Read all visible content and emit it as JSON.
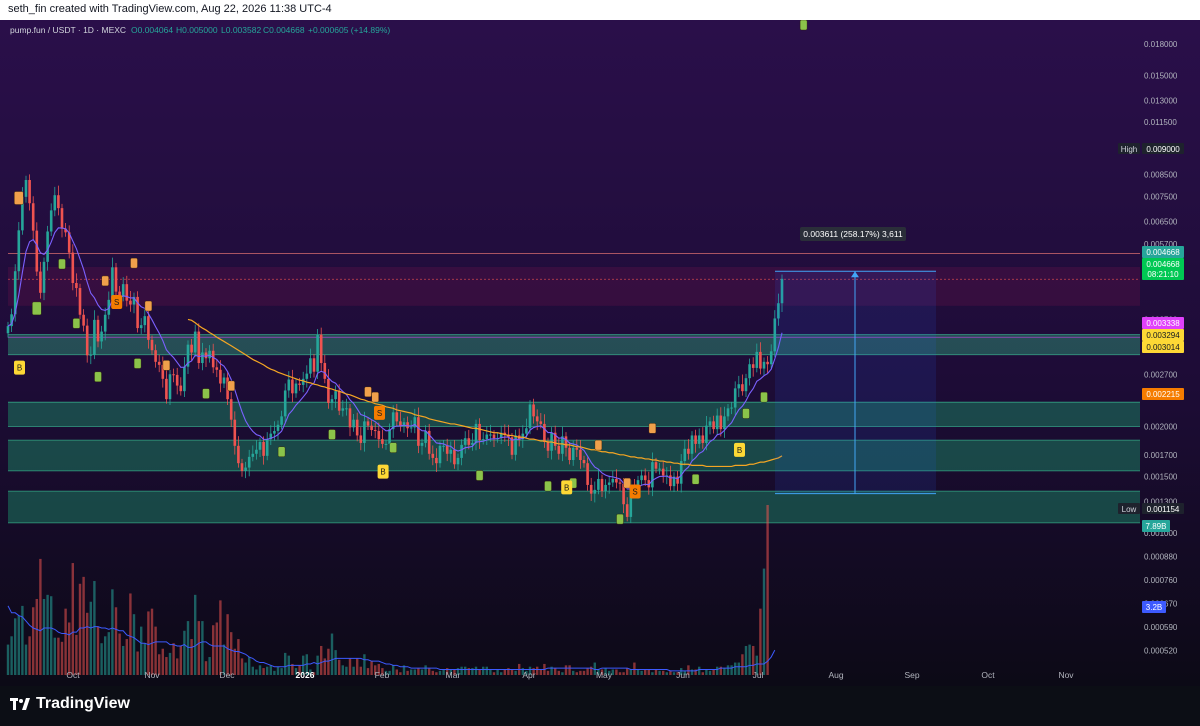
{
  "header": {
    "credit": "seth_fin created with TradingView.com, Aug 22, 2026 11:38 UTC-4"
  },
  "legend": {
    "symbol": "pump.fun / USDT · 1D · MEXC",
    "open": "O0.004064",
    "high": "H0.005000",
    "low": "L0.003582",
    "close": "C0.004668",
    "change": "+0.000605 (+14.89%)"
  },
  "price_scale": {
    "ticks": [
      "0.018000",
      "0.015000",
      "0.013000",
      "0.011500",
      "0.010000",
      "0.008500",
      "0.007500",
      "0.006500",
      "0.005700",
      "0.003700",
      "0.002700",
      "0.002000",
      "0.001700",
      "0.001500",
      "0.001300",
      "0.001000",
      "0.000880",
      "0.000760",
      "0.000670",
      "0.000590",
      "0.000520"
    ],
    "high_tag": "High",
    "high_value": "0.009000",
    "low_tag": "Low",
    "low_value": "0.001154",
    "last_price": "0.004668",
    "close_price": "0.004668",
    "countdown": "08:21:10",
    "level_a": "0.003338",
    "level_b": "0.003294",
    "level_c": "0.003014",
    "ma_value": "0.002215",
    "vol_high": "7.89B",
    "vol_ma": "3.2B"
  },
  "time_axis": [
    "Oct",
    "Nov",
    "Dec",
    "2026",
    "Feb",
    "Mar",
    "Apr",
    "May",
    "Jun",
    "Jul",
    "Aug",
    "Sep",
    "Oct",
    "Nov"
  ],
  "measure": {
    "label": "0.003611 (258.17%) 3,611"
  },
  "signal_letters": {
    "buy": "B",
    "sell": "S"
  },
  "footer": {
    "brand": "TradingView"
  },
  "colors": {
    "bg_top": "#2a0f4a",
    "bg_bottom": "#0f0a1c",
    "up": "#26a69a",
    "down": "#ef5350",
    "zone": "#1b7a5f",
    "ma_long": "#f5a623",
    "ma_short": "#7b61ff",
    "accent": "#5c6bc0"
  },
  "chart_data": {
    "type": "candlestick",
    "scale": "log",
    "ylim": [
      0.00048,
      0.0195
    ],
    "x_start": "2025-09-08",
    "x_end": "2026-11-30",
    "close": [
      0.00356,
      0.00381,
      0.00488,
      0.00617,
      0.00748,
      0.00824,
      0.00721,
      0.00616,
      0.00487,
      0.00431,
      0.00515,
      0.00613,
      0.00692,
      0.00755,
      0.00701,
      0.00623,
      0.0061,
      0.00543,
      0.00456,
      0.00443,
      0.0038,
      0.00357,
      0.00301,
      0.00302,
      0.00369,
      0.00326,
      0.00345,
      0.0038,
      0.00414,
      0.00499,
      0.00434,
      0.00421,
      0.00453,
      0.00412,
      0.00403,
      0.00421,
      0.00352,
      0.00358,
      0.00377,
      0.00329,
      0.0031,
      0.0029,
      0.00285,
      0.00263,
      0.00234,
      0.0027,
      0.00269,
      0.00253,
      0.00245,
      0.00282,
      0.0032,
      0.00306,
      0.00345,
      0.00288,
      0.00306,
      0.00296,
      0.00309,
      0.00281,
      0.00277,
      0.00256,
      0.00265,
      0.00234,
      0.00208,
      0.00179,
      0.00162,
      0.00155,
      0.00158,
      0.00168,
      0.00171,
      0.00175,
      0.00183,
      0.00169,
      0.00186,
      0.00192,
      0.00195,
      0.00202,
      0.00212,
      0.00246,
      0.00262,
      0.00242,
      0.00256,
      0.00254,
      0.00263,
      0.00271,
      0.00296,
      0.00274,
      0.00339,
      0.00288,
      0.00263,
      0.00229,
      0.00234,
      0.00245,
      0.00219,
      0.00222,
      0.00222,
      0.00199,
      0.00208,
      0.0019,
      0.00182,
      0.00206,
      0.00201,
      0.00196,
      0.00195,
      0.00186,
      0.00181,
      0.00181,
      0.00197,
      0.00217,
      0.00206,
      0.00201,
      0.00205,
      0.00198,
      0.00199,
      0.00211,
      0.00179,
      0.00182,
      0.00195,
      0.00171,
      0.00167,
      0.00162,
      0.00179,
      0.00179,
      0.00171,
      0.00175,
      0.00161,
      0.00167,
      0.0018,
      0.00187,
      0.0018,
      0.00182,
      0.00203,
      0.00185,
      0.00186,
      0.00191,
      0.00191,
      0.00187,
      0.00187,
      0.00193,
      0.00191,
      0.00188,
      0.0017,
      0.0019,
      0.00186,
      0.00192,
      0.00198,
      0.00227,
      0.00212,
      0.00206,
      0.00203,
      0.00183,
      0.00174,
      0.00193,
      0.00179,
      0.00171,
      0.00189,
      0.00177,
      0.00165,
      0.00177,
      0.00175,
      0.00165,
      0.00162,
      0.00143,
      0.00136,
      0.00139,
      0.00148,
      0.00138,
      0.00143,
      0.00145,
      0.00148,
      0.00145,
      0.00144,
      0.00128,
      0.00119,
      0.0014,
      0.00139,
      0.00147,
      0.00151,
      0.00147,
      0.00141,
      0.00163,
      0.00157,
      0.00157,
      0.00151,
      0.00151,
      0.00142,
      0.0015,
      0.00144,
      0.00164,
      0.00176,
      0.00171,
      0.0019,
      0.00181,
      0.0019,
      0.00182,
      0.00201,
      0.00206,
      0.00197,
      0.00213,
      0.00197,
      0.00212,
      0.00222,
      0.00223,
      0.00249,
      0.00255,
      0.00245,
      0.00264,
      0.00286,
      0.0028,
      0.00307,
      0.00279,
      0.0029,
      0.00286,
      0.00308,
      0.00372,
      0.00406,
      0.00467
    ],
    "ma_long": [
      null,
      null,
      null,
      null,
      null,
      null,
      null,
      null,
      null,
      null,
      null,
      null,
      null,
      null,
      null,
      null,
      null,
      null,
      null,
      null,
      null,
      null,
      null,
      null,
      null,
      null,
      null,
      null,
      null,
      null,
      null,
      null,
      null,
      null,
      null,
      null,
      null,
      null,
      null,
      null,
      null,
      null,
      null,
      null,
      null,
      null,
      null,
      null,
      null,
      null,
      0.0037,
      0.00368,
      0.00363,
      0.00357,
      0.00352,
      0.00348,
      0.00343,
      0.00339,
      0.00334,
      0.0033,
      0.00326,
      0.00322,
      0.00318,
      0.00314,
      0.0031,
      0.00306,
      0.00302,
      0.00298,
      0.00294,
      0.00291,
      0.00288,
      0.00285,
      0.00281,
      0.00278,
      0.00276,
      0.00273,
      0.00271,
      0.00269,
      0.00267,
      0.00265,
      0.00263,
      0.00261,
      0.0026,
      0.00258,
      0.00257,
      0.00255,
      0.00254,
      0.00252,
      0.00251,
      0.00249,
      0.00248,
      0.00246,
      0.00245,
      0.00243,
      0.00241,
      0.0024,
      0.00238,
      0.00236,
      0.00234,
      0.00233,
      0.00231,
      0.0023,
      0.00228,
      0.00227,
      0.00226,
      0.00224,
      0.00223,
      0.00222,
      0.0022,
      0.00219,
      0.00218,
      0.00217,
      0.00216,
      0.00214,
      0.00213,
      0.00212,
      0.00211,
      0.00209,
      0.00208,
      0.00207,
      0.00206,
      0.00205,
      0.00204,
      0.00203,
      0.00203,
      0.00202,
      0.00201,
      0.002,
      0.00199,
      0.00198,
      0.00198,
      0.00197,
      0.00196,
      0.00195,
      0.00194,
      0.00193,
      0.00193,
      0.00192,
      0.00191,
      0.0019,
      0.0019,
      0.00189,
      0.00188,
      0.00188,
      0.00187,
      0.00186,
      0.00186,
      0.00185,
      0.00184,
      0.00184,
      0.00183,
      0.00183,
      0.00182,
      0.00181,
      0.00181,
      0.0018,
      0.0018,
      0.00179,
      0.00178,
      0.00178,
      0.00177,
      0.00176,
      0.00175,
      0.00175,
      0.00174,
      0.00173,
      0.00173,
      0.00172,
      0.00172,
      0.00171,
      0.0017,
      0.0017,
      0.00169,
      0.00168,
      0.00168,
      0.00167,
      0.00167,
      0.00166,
      0.00166,
      0.00165,
      0.00165,
      0.00164,
      0.00164,
      0.00163,
      0.00163,
      0.00162,
      0.00162,
      0.00161,
      0.00161,
      0.00161,
      0.0016,
      0.0016,
      0.0016,
      0.0016,
      0.00159,
      0.00159,
      0.00159,
      0.00159,
      0.00159,
      0.00159,
      0.00159,
      0.00159,
      0.0016,
      0.0016,
      0.0016,
      0.0016,
      0.00161,
      0.00161,
      0.00162,
      0.00163,
      0.00163,
      0.00164,
      0.00165,
      0.00166,
      0.00167,
      0.00169
    ],
    "volume": [
      0.22,
      0.28,
      0.41,
      0.43,
      0.5,
      0.22,
      0.28,
      0.49,
      0.55,
      0.84,
      0.55,
      0.58,
      0.57,
      0.27,
      0.27,
      0.24,
      0.48,
      0.38,
      0.81,
      0.29,
      0.66,
      0.71,
      0.45,
      0.53,
      0.68,
      0.35,
      0.23,
      0.28,
      0.31,
      0.62,
      0.49,
      0.3,
      0.21,
      0.26,
      0.59,
      0.44,
      0.17,
      0.35,
      0.23,
      0.46,
      0.48,
      0.35,
      0.15,
      0.19,
      0.13,
      0.16,
      0.23,
      0.12,
      0.21,
      0.32,
      0.39,
      0.26,
      0.58,
      0.39,
      0.39,
      0.1,
      0.13,
      0.36,
      0.38,
      0.54,
      0.22,
      0.44,
      0.31,
      0.19,
      0.26,
      0.12,
      0.09,
      0.13,
      0.06,
      0.04,
      0.07,
      0.05,
      0.06,
      0.07,
      0.03,
      0.06,
      0.05,
      0.16,
      0.14,
      0.08,
      0.05,
      0.07,
      0.14,
      0.15,
      0.04,
      0.02,
      0.14,
      0.21,
      0.12,
      0.19,
      0.3,
      0.18,
      0.11,
      0.07,
      0.06,
      0.12,
      0.06,
      0.12,
      0.06,
      0.15,
      0.05,
      0.1,
      0.07,
      0.08,
      0.05,
      0.03,
      0.03,
      0.07,
      0.04,
      0.02,
      0.07,
      0.03,
      0.04,
      0.04,
      0.05,
      0.04,
      0.07,
      0.05,
      0.03,
      0.02,
      0.03,
      0.04,
      0.05,
      0.04,
      0.04,
      0.05,
      0.06,
      0.06,
      0.05,
      0.05,
      0.06,
      0.04,
      0.06,
      0.06,
      0.04,
      0.02,
      0.04,
      0.02,
      0.04,
      0.05,
      0.04,
      0.03,
      0.08,
      0.05,
      0.03,
      0.06,
      0.05,
      0.06,
      0.04,
      0.08,
      0.03,
      0.06,
      0.05,
      0.03,
      0.02,
      0.07,
      0.07,
      0.03,
      0.02,
      0.03,
      0.03,
      0.05,
      0.06,
      0.09,
      0.04,
      0.04,
      0.05,
      0.03,
      0.04,
      0.04,
      0.02,
      0.02,
      0.05,
      0.04,
      0.09,
      0.04,
      0.03,
      0.04,
      0.04,
      0.02,
      0.04,
      0.03,
      0.03,
      0.02,
      0.03,
      0.02,
      0.02,
      0.05,
      0.03,
      0.07,
      0.04,
      0.04,
      0.06,
      0.02,
      0.04,
      0.03,
      0.04,
      0.06,
      0.06,
      0.05,
      0.07,
      0.07,
      0.09,
      0.09,
      0.15,
      0.21,
      0.22,
      0.21,
      0.14,
      0.48,
      0.77,
      1.23
    ],
    "vol_ma": [
      0.5,
      0.45,
      0.45,
      0.43,
      0.42,
      0.39,
      0.36,
      0.34,
      0.33,
      0.32,
      0.34,
      0.34,
      0.34,
      0.33,
      0.31,
      0.3,
      0.3,
      0.29,
      0.31,
      0.31,
      0.34,
      0.34,
      0.35,
      0.34,
      0.35,
      0.35,
      0.34,
      0.34,
      0.33,
      0.34,
      0.33,
      0.32,
      0.32,
      0.29,
      0.28,
      0.27,
      0.25,
      0.23,
      0.23,
      0.22,
      0.23,
      0.24,
      0.24,
      0.24,
      0.24,
      0.22,
      0.22,
      0.21,
      0.21,
      0.22,
      0.2,
      0.2,
      0.21,
      0.23,
      0.24,
      0.24,
      0.22,
      0.21,
      0.21,
      0.21,
      0.21,
      0.19,
      0.18,
      0.17,
      0.17,
      0.16,
      0.15,
      0.13,
      0.12,
      0.1,
      0.09,
      0.09,
      0.08,
      0.07,
      0.06,
      0.06,
      0.06,
      0.06,
      0.07,
      0.07,
      0.07,
      0.07,
      0.07,
      0.08,
      0.08,
      0.09,
      0.08,
      0.09,
      0.1,
      0.1,
      0.11,
      0.12,
      0.12,
      0.12,
      0.12,
      0.12,
      0.12,
      0.12,
      0.12,
      0.11,
      0.11,
      0.1,
      0.1,
      0.1,
      0.09,
      0.08,
      0.08,
      0.07,
      0.07,
      0.06,
      0.06,
      0.06,
      0.05,
      0.05,
      0.05,
      0.05,
      0.05,
      0.05,
      0.05,
      0.05,
      0.04,
      0.04,
      0.04,
      0.04,
      0.04,
      0.04,
      0.04,
      0.04,
      0.04,
      0.04,
      0.04,
      0.04,
      0.04,
      0.04,
      0.04,
      0.04,
      0.04,
      0.04,
      0.04,
      0.04,
      0.04,
      0.04,
      0.04,
      0.04,
      0.04,
      0.04,
      0.04,
      0.04,
      0.04,
      0.04,
      0.05,
      0.05,
      0.05,
      0.05,
      0.05,
      0.05,
      0.05,
      0.05,
      0.05,
      0.05,
      0.05,
      0.05,
      0.05,
      0.04,
      0.04,
      0.05,
      0.05,
      0.05,
      0.05,
      0.05,
      0.05,
      0.05,
      0.05,
      0.04,
      0.04,
      0.04,
      0.04,
      0.04,
      0.04,
      0.04,
      0.04,
      0.04,
      0.04,
      0.04,
      0.03,
      0.03,
      0.03,
      0.03,
      0.03,
      0.03,
      0.03,
      0.03,
      0.04,
      0.04,
      0.04,
      0.04,
      0.04,
      0.04,
      0.05,
      0.05,
      0.05,
      0.05,
      0.06,
      0.06,
      0.06,
      0.06,
      0.07,
      0.07,
      0.08,
      0.08,
      0.08,
      0.1,
      0.13,
      0.18
    ]
  }
}
